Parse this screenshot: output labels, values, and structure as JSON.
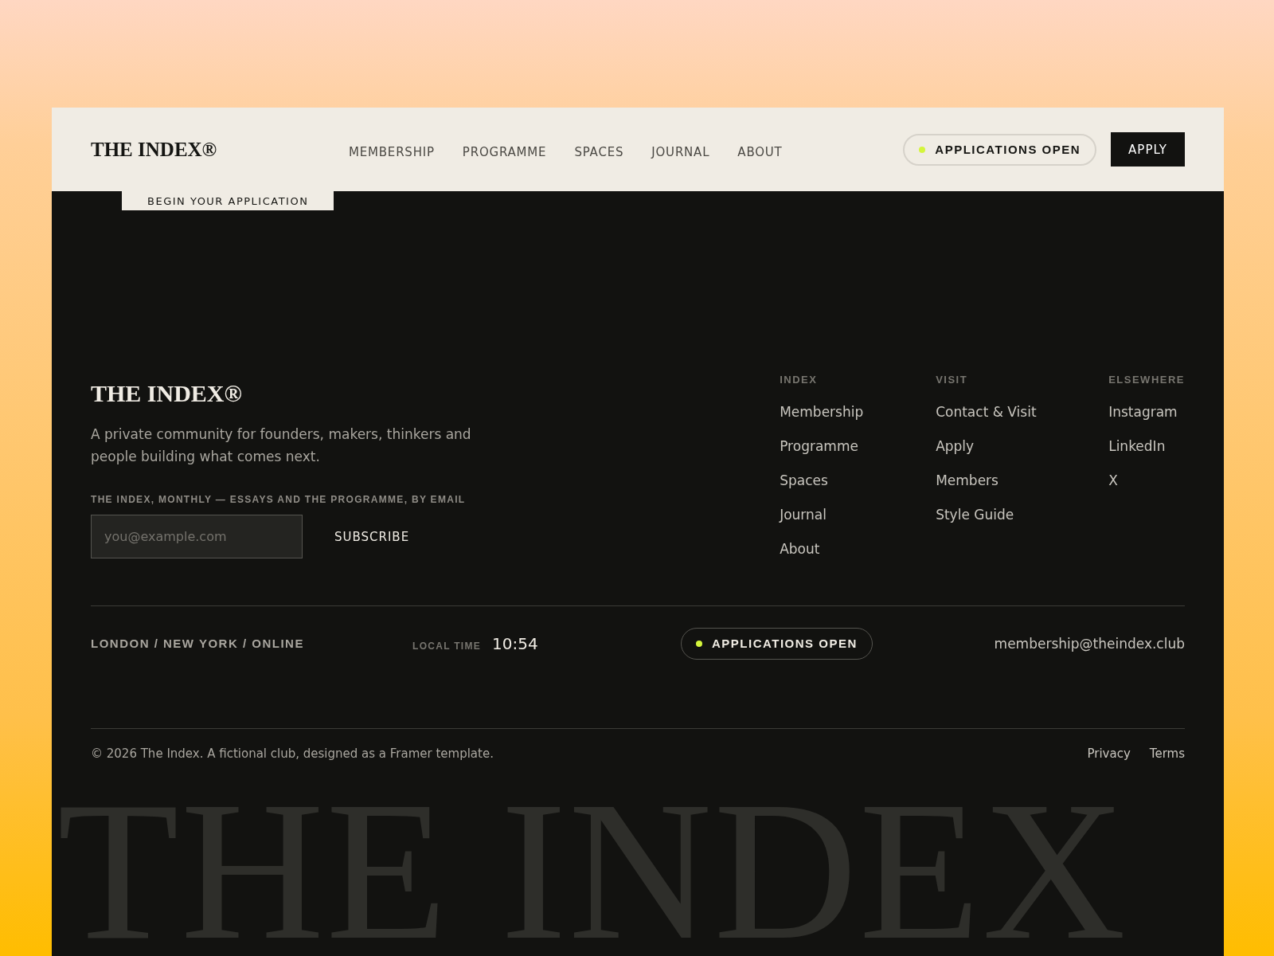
{
  "header": {
    "logo": "THE INDEX®",
    "nav": [
      {
        "label": "MEMBERSHIP"
      },
      {
        "label": "PROGRAMME"
      },
      {
        "label": "SPACES"
      },
      {
        "label": "JOURNAL"
      },
      {
        "label": "ABOUT"
      }
    ],
    "status_pill": {
      "label": "APPLICATIONS OPEN"
    },
    "apply_button": "APPLY"
  },
  "hero": {
    "cta_button": "BEGIN YOUR APPLICATION"
  },
  "footer": {
    "logo": "THE INDEX®",
    "tagline": "A private community for founders, makers, thinkers and people building what comes next.",
    "newsletter": {
      "label": "THE INDEX, MONTHLY — ESSAYS AND THE PROGRAMME, BY EMAIL",
      "placeholder": "you@example.com",
      "button": "SUBSCRIBE"
    },
    "columns": [
      {
        "heading": "INDEX",
        "links": [
          "Membership",
          "Programme",
          "Spaces",
          "Journal",
          "About"
        ]
      },
      {
        "heading": "VISIT",
        "links": [
          "Contact & Visit",
          "Apply",
          "Members",
          "Style Guide"
        ]
      },
      {
        "heading": "ELSEWHERE",
        "links": [
          "Instagram",
          "LinkedIn",
          "X"
        ]
      }
    ],
    "info_bar": {
      "locations": "LONDON / NEW YORK / ONLINE",
      "time_label": "LOCAL TIME",
      "time": "10:54",
      "status_pill": {
        "label": "APPLICATIONS OPEN"
      },
      "email": "membership@theindex.club"
    },
    "copyright": "© 2026 The Index. A fictional club, designed as a Framer template.",
    "legal_links": [
      "Privacy",
      "Terms"
    ],
    "wordmark": "THE INDEX"
  }
}
